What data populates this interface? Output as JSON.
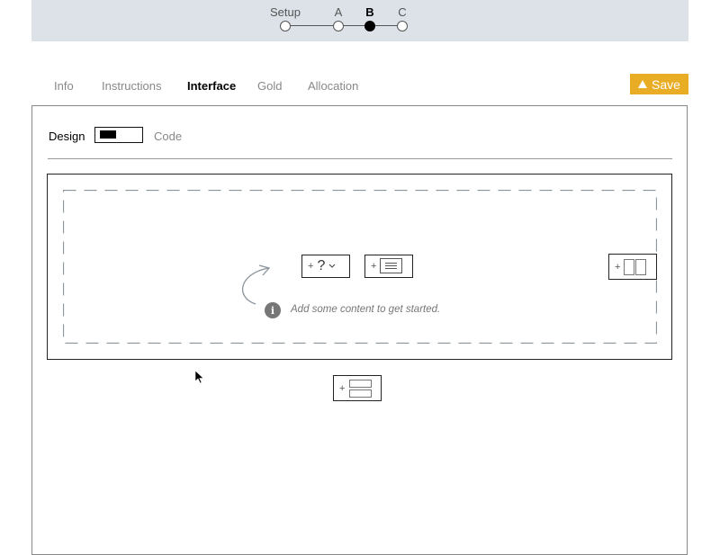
{
  "stepper": {
    "steps": [
      {
        "label": "Setup",
        "active": false
      },
      {
        "label": "A",
        "active": false
      },
      {
        "label": "B",
        "active": true
      },
      {
        "label": "C",
        "active": false
      }
    ]
  },
  "tabs": [
    {
      "label": "Info",
      "active": false
    },
    {
      "label": "Instructions",
      "active": false
    },
    {
      "label": "Interface",
      "active": true
    },
    {
      "label": "Gold",
      "active": false
    },
    {
      "label": "Allocation",
      "active": false
    }
  ],
  "save_button": {
    "label": "Save",
    "icon": "warning-triangle-icon",
    "color": "#e8ac25"
  },
  "mode_toggle": {
    "left_label": "Design",
    "right_label": "Code",
    "selected": "Design"
  },
  "editor": {
    "hint_icon": "info-icon",
    "hint_icon_glyph": "i",
    "hint_text": "Add some content to get started.",
    "add_buttons": [
      {
        "name": "add-question-button",
        "icon": "question-dropdown-icon",
        "glyph": "?",
        "plus": "+"
      },
      {
        "name": "add-text-button",
        "icon": "text-block-icon",
        "plus": "+"
      },
      {
        "name": "add-columns-button",
        "icon": "two-columns-icon",
        "plus": "+"
      },
      {
        "name": "add-rows-button",
        "icon": "two-rows-icon",
        "plus": "+"
      }
    ]
  }
}
